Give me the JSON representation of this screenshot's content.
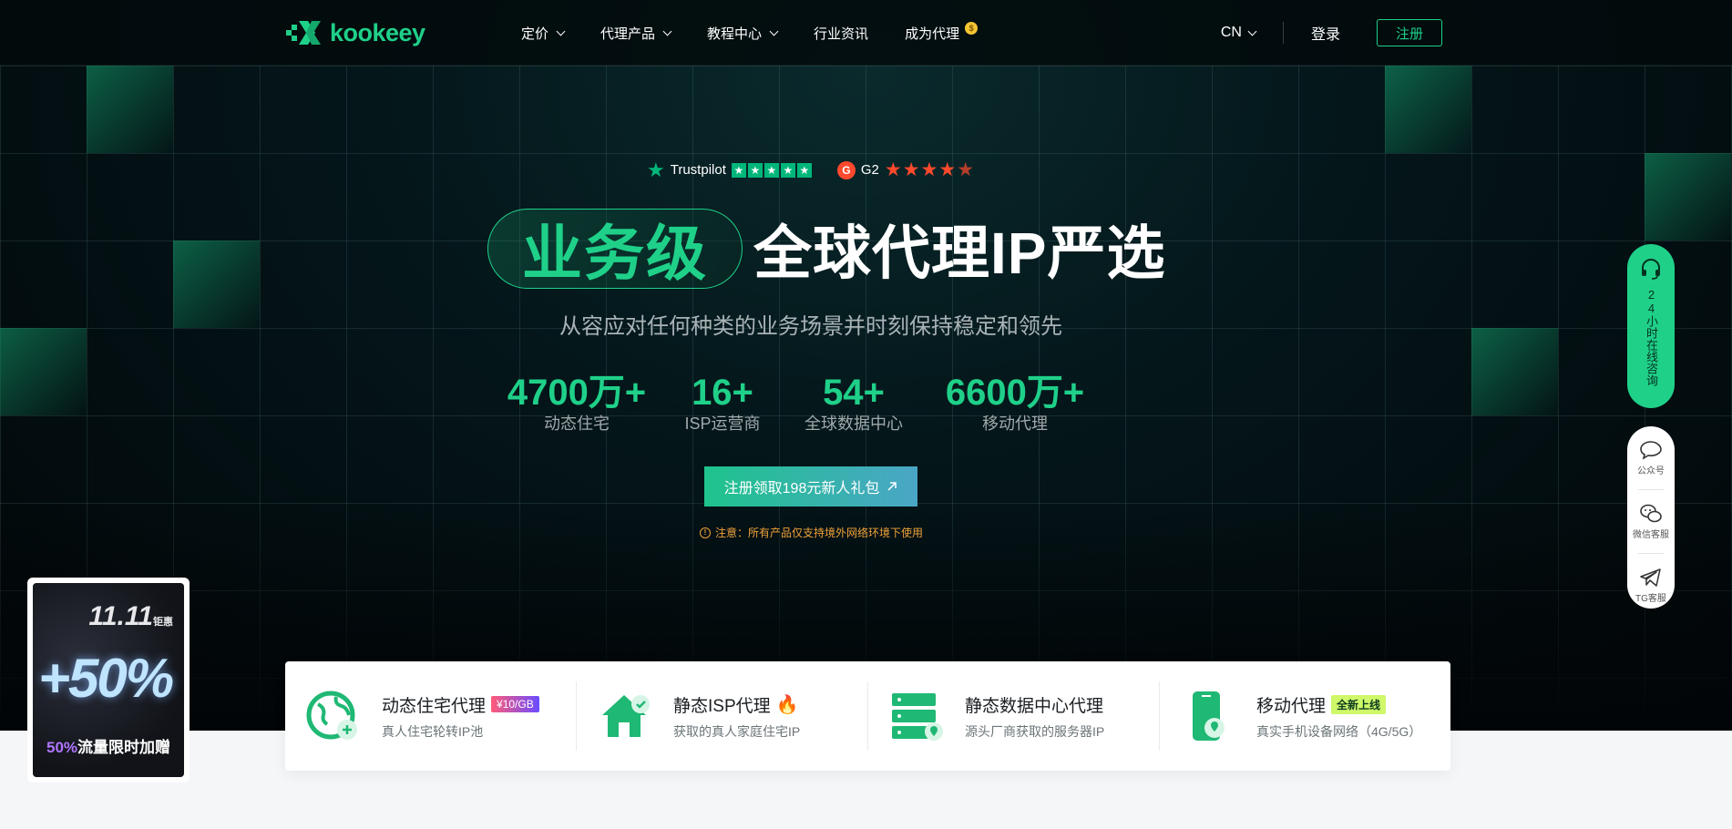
{
  "brand": {
    "name": "kookeey",
    "accent": "#1fd089"
  },
  "nav": {
    "items": [
      {
        "label": "定价",
        "dropdown": true
      },
      {
        "label": "代理产品",
        "dropdown": true
      },
      {
        "label": "教程中心",
        "dropdown": true
      },
      {
        "label": "行业资讯",
        "dropdown": false
      },
      {
        "label": "成为代理",
        "dropdown": false
      }
    ],
    "coin_glyph": "$",
    "lang": "CN",
    "login": "登录",
    "register": "注册"
  },
  "ratings": {
    "trustpilot": "Trustpilot",
    "g2": "G2",
    "g2_logo": "G"
  },
  "hero": {
    "highlight": "业务级",
    "title_rest": "全球代理IP严选",
    "subtitle": "从容应对任何种类的业务场景并时刻保持稳定和领先",
    "stats": [
      {
        "value": "4700万+",
        "label": "动态住宅"
      },
      {
        "value": "16+",
        "label": "ISP运营商"
      },
      {
        "value": "54+",
        "label": "全球数据中心"
      },
      {
        "value": "6600万+",
        "label": "移动代理"
      }
    ],
    "cta": "注册领取198元新人礼包",
    "notice": "注意：所有产品仅支持境外网络环境下使用"
  },
  "sidebar": {
    "consult": "24小时在线咨询",
    "buttons": [
      {
        "label": "公众号",
        "icon": "chat-bubble-icon"
      },
      {
        "label": "微信客服",
        "icon": "wechat-icon"
      },
      {
        "label": "TG客服",
        "icon": "telegram-icon"
      }
    ]
  },
  "promo": {
    "date": "11.11",
    "date_suffix": "钜惠",
    "percent": "+50%",
    "tag_highlight": "50%",
    "tag_rest": "流量限时加赠"
  },
  "products": [
    {
      "title": "动态住宅代理",
      "badge": "¥10/GB",
      "badge_type": "price",
      "desc": "真人住宅轮转IP池",
      "icon": "globe-icon"
    },
    {
      "title": "静态ISP代理",
      "badge": "",
      "badge_type": "hot",
      "desc": "获取的真人家庭住宅IP",
      "icon": "house-icon"
    },
    {
      "title": "静态数据中心代理",
      "badge": "",
      "badge_type": "none",
      "desc": "源头厂商获取的服务器IP",
      "icon": "server-icon"
    },
    {
      "title": "移动代理",
      "badge": "全新上线",
      "badge_type": "new",
      "desc": "真实手机设备网络（4G/5G）",
      "icon": "phone-icon"
    }
  ]
}
